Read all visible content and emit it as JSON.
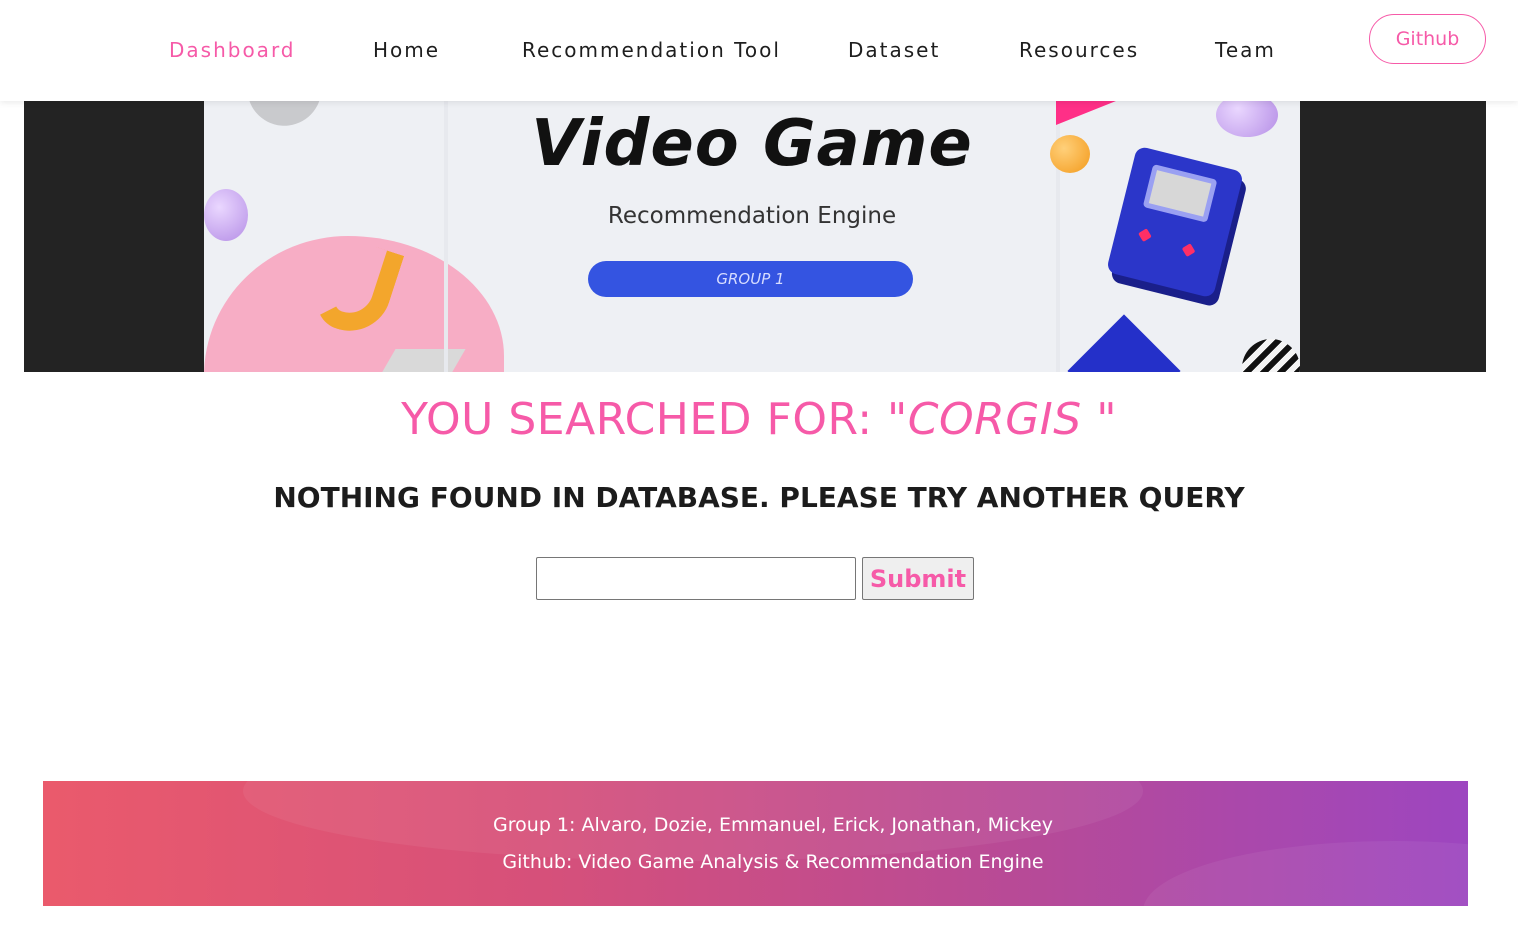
{
  "nav": {
    "items": [
      {
        "label": "Dashboard",
        "active": true
      },
      {
        "label": "Home",
        "active": false
      },
      {
        "label": "Recommendation Tool",
        "active": false
      },
      {
        "label": "Dataset",
        "active": false
      },
      {
        "label": "Resources",
        "active": false
      },
      {
        "label": "Team",
        "active": false
      }
    ],
    "github_label": "Github"
  },
  "banner": {
    "title": "Video Game",
    "subtitle": "Recommendation Engine",
    "pill": "GROUP 1"
  },
  "search": {
    "prefix": "YOU SEARCHED FOR: \"",
    "query": "CORGIS",
    "suffix": " \"",
    "message": "NOTHING FOUND IN DATABASE. PLEASE TRY ANOTHER QUERY",
    "input_value": "",
    "submit_label": "Submit"
  },
  "footer": {
    "line1": "Group 1: Alvaro, Dozie, Emmanuel, Erick, Jonathan, Mickey",
    "line2": "Github: Video Game Analysis & Recommendation Engine"
  },
  "colors": {
    "accent": "#f65aa8",
    "text": "#1d1d1d",
    "footer_start": "#ea5a6c",
    "footer_end": "#9d46c0"
  }
}
